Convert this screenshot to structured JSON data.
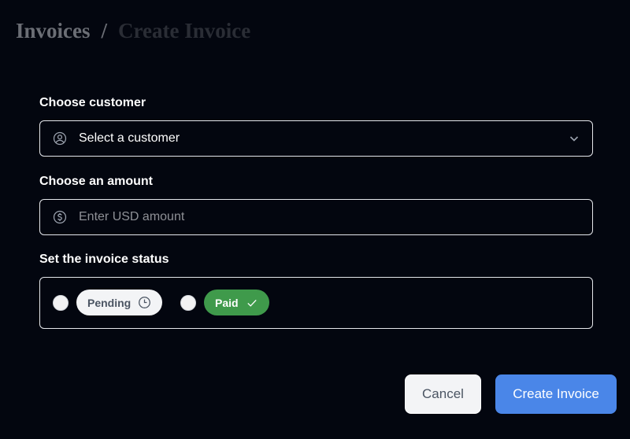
{
  "breadcrumb": {
    "parent": "Invoices",
    "separator": "/",
    "current": "Create Invoice"
  },
  "form": {
    "customer_label": "Choose customer",
    "customer_select": {
      "value": "Select a customer",
      "icon": "user-circle-icon"
    },
    "amount_label": "Choose an amount",
    "amount_input": {
      "placeholder": "Enter USD amount",
      "value": "",
      "icon": "dollar-circle-icon"
    },
    "status_label": "Set the invoice status",
    "status_options": [
      {
        "label": "Pending",
        "icon": "clock-icon",
        "selected": false
      },
      {
        "label": "Paid",
        "icon": "check-icon",
        "selected": false
      }
    ]
  },
  "actions": {
    "cancel_label": "Cancel",
    "create_label": "Create Invoice"
  },
  "colors": {
    "background": "#03060f",
    "primary": "#4a86e8",
    "paid_green": "#3f9a4b"
  }
}
